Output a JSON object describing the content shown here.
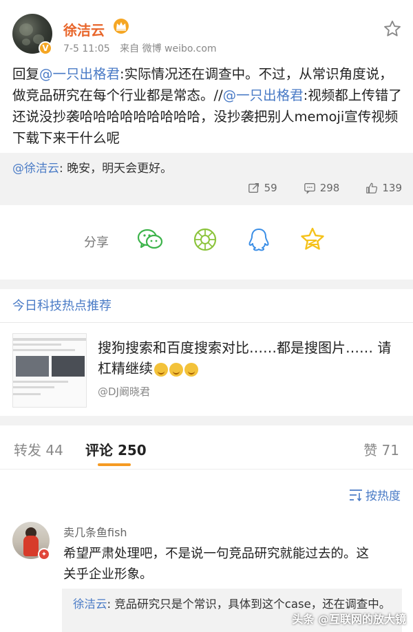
{
  "post": {
    "author": "徐洁云",
    "time": "7-5 11:05",
    "source": "来自 微博 weibo.com",
    "text_reply_prefix": "回复",
    "mention1": "@一只出格君",
    "text_part1": ":实际情况还在调查中。不过，从常识角度说，做竞品研究在每个行业都是常态。//",
    "mention2": "@一只出格君",
    "text_part2": ":视频都上传错了还说没抄袭哈哈哈哈哈哈哈哈哈，没抄袭把别人memoji宣传视频下载下来干什么呢",
    "repost_mention": "@徐洁云",
    "repost_text": ": 晚安，明天会更好。",
    "stats": {
      "reposts": "59",
      "comments": "298",
      "likes": "139"
    }
  },
  "share": {
    "label": "分享",
    "icons": [
      "wechat-icon",
      "moments-icon",
      "qq-icon",
      "qzone-icon"
    ],
    "colors": {
      "wechat": "#3cb34a",
      "moments": "#8cc43c",
      "qq": "#3a8ee6",
      "qzone": "#f5c21b"
    }
  },
  "hot": {
    "title": "今日科技热点推荐",
    "headline": "搜狗搜索和百度搜索对比……都是搜图片…… 请杠精继续",
    "author": "@DJ阚晓君"
  },
  "tabs": {
    "repost": "转发 44",
    "comment": "评论 250",
    "like": "赞 71"
  },
  "sort_label": "按热度",
  "comment": {
    "name": "卖几条鱼fish",
    "text": "希望严肃处理吧，不是说一句竞品研究就能过去的。这关乎企业形象。",
    "reply_author": "徐洁云",
    "reply_text": ": 竞品研究只是个常识，具体到这个case，还在调查中。"
  },
  "watermark": "头条 @互联网的放大镜",
  "colors": {
    "author": "#e8662b",
    "link": "#4a7bc6",
    "accent": "#f59a23",
    "bg_grey": "#f2f2f2"
  }
}
